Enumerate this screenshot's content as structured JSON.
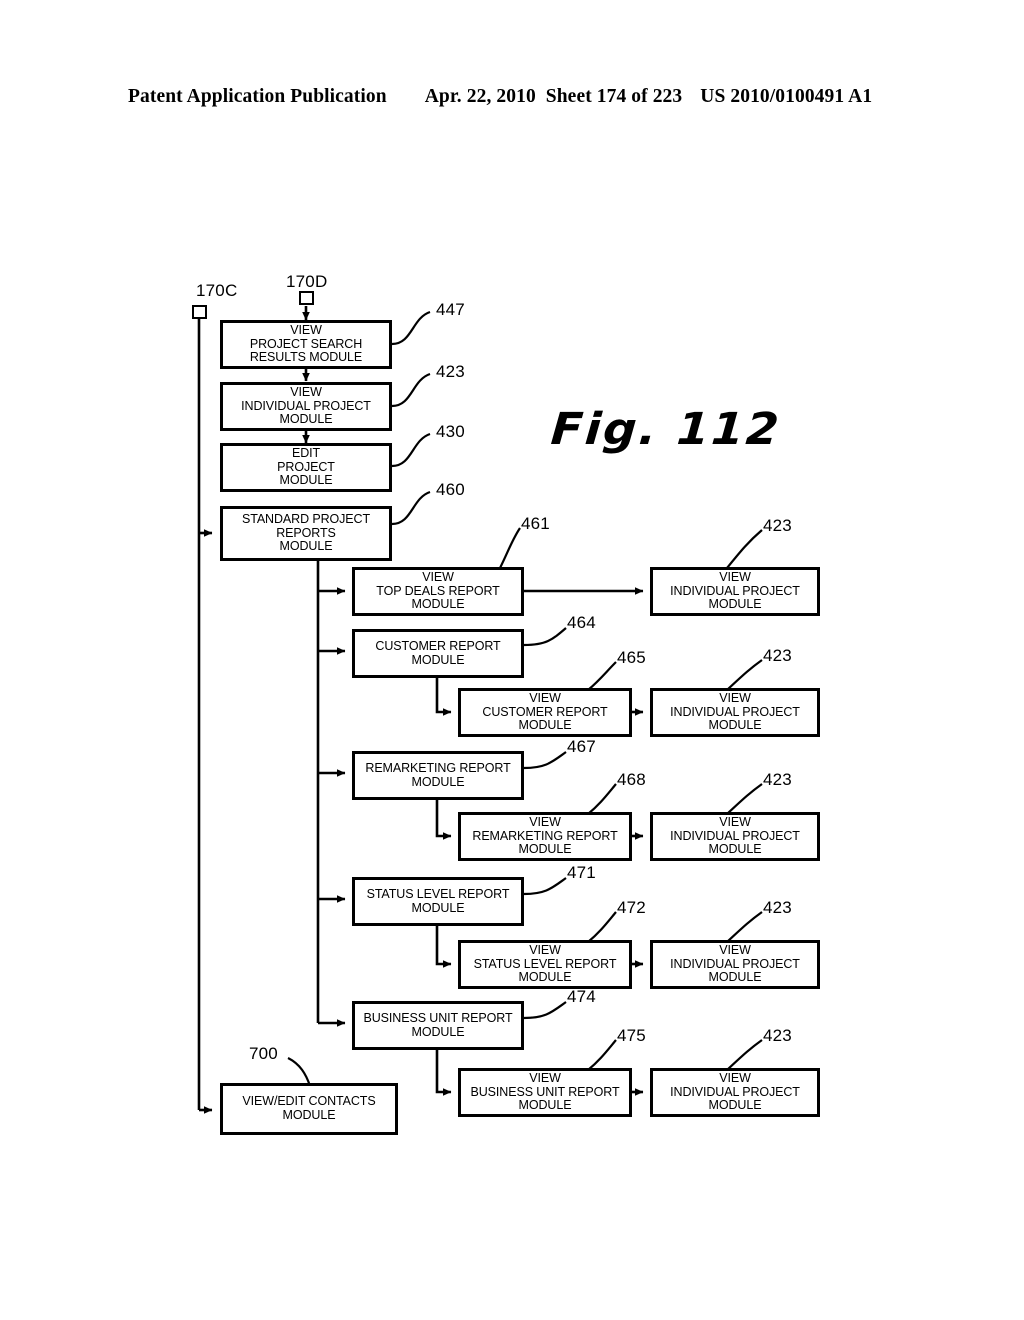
{
  "header": {
    "publication": "Patent Application Publication",
    "date": "Apr. 22, 2010",
    "sheet": "Sheet 174 of 223",
    "pub_number": "US 2010/0100491 A1"
  },
  "figure": {
    "label": "Fig. 112"
  },
  "connectors": [
    {
      "id": "170C",
      "label": "170C"
    },
    {
      "id": "170D",
      "label": "170D"
    }
  ],
  "boxes": {
    "view_project_search_results": {
      "lines": [
        "VIEW",
        "PROJECT SEARCH",
        "RESULTS MODULE"
      ],
      "ref": "447"
    },
    "view_individual_project_1": {
      "lines": [
        "VIEW",
        "INDIVIDUAL PROJECT",
        "MODULE"
      ],
      "ref": "423"
    },
    "edit_project": {
      "lines": [
        "EDIT",
        "PROJECT",
        "MODULE"
      ],
      "ref": "430"
    },
    "standard_project_reports": {
      "lines": [
        "STANDARD PROJECT",
        "REPORTS",
        "MODULE"
      ],
      "ref": "460"
    },
    "view_top_deals_report": {
      "lines": [
        "VIEW",
        "TOP DEALS REPORT",
        "MODULE"
      ],
      "ref": "461"
    },
    "view_individual_project_2": {
      "lines": [
        "VIEW",
        "INDIVIDUAL PROJECT",
        "MODULE"
      ],
      "ref": "423"
    },
    "customer_report": {
      "lines": [
        "CUSTOMER REPORT",
        "MODULE"
      ],
      "ref": "464"
    },
    "view_customer_report": {
      "lines": [
        "VIEW",
        "CUSTOMER REPORT",
        "MODULE"
      ],
      "ref": "465"
    },
    "view_individual_project_3": {
      "lines": [
        "VIEW",
        "INDIVIDUAL PROJECT",
        "MODULE"
      ],
      "ref": "423"
    },
    "remarketing_report": {
      "lines": [
        "REMARKETING REPORT",
        "MODULE"
      ],
      "ref": "467"
    },
    "view_remarketing_report": {
      "lines": [
        "VIEW",
        "REMARKETING REPORT",
        "MODULE"
      ],
      "ref": "468"
    },
    "view_individual_project_4": {
      "lines": [
        "VIEW",
        "INDIVIDUAL PROJECT",
        "MODULE"
      ],
      "ref": "423"
    },
    "status_level_report": {
      "lines": [
        "STATUS LEVEL REPORT",
        "MODULE"
      ],
      "ref": "471"
    },
    "view_status_level_report": {
      "lines": [
        "VIEW",
        "STATUS LEVEL REPORT",
        "MODULE"
      ],
      "ref": "472"
    },
    "view_individual_project_5": {
      "lines": [
        "VIEW",
        "INDIVIDUAL PROJECT",
        "MODULE"
      ],
      "ref": "423"
    },
    "business_unit_report": {
      "lines": [
        "BUSINESS UNIT REPORT",
        "MODULE"
      ],
      "ref": "474"
    },
    "view_business_unit_report": {
      "lines": [
        "VIEW",
        "BUSINESS UNIT REPORT",
        "MODULE"
      ],
      "ref": "475"
    },
    "view_individual_project_6": {
      "lines": [
        "VIEW",
        "INDIVIDUAL PROJECT",
        "MODULE"
      ],
      "ref": "423"
    },
    "view_edit_contacts": {
      "lines": [
        "VIEW/EDIT CONTACTS",
        "MODULE"
      ],
      "ref": "700"
    }
  },
  "colors": {
    "ink": "#000000",
    "paper": "#ffffff"
  }
}
